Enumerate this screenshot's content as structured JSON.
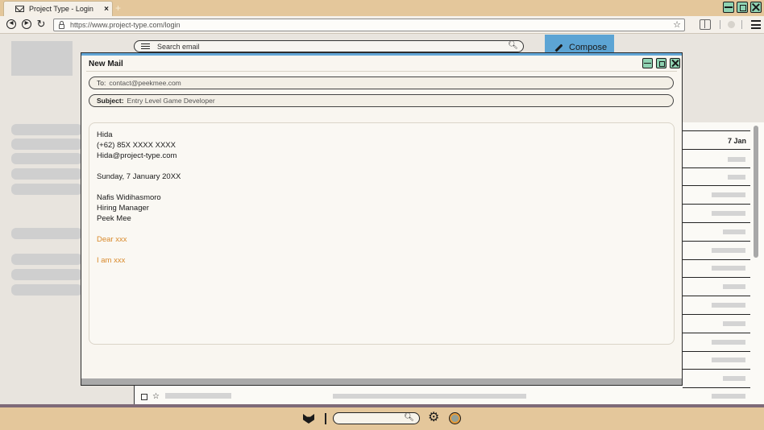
{
  "browser": {
    "tab_title": "Project Type - Login",
    "tab_close": "×",
    "new_tab": "+",
    "url": "https://www.project-type.com/login",
    "star": "☆"
  },
  "app": {
    "search_placeholder": "Search email",
    "compose_label": "Compose",
    "list": {
      "first_date": "7 Jan"
    }
  },
  "new_mail": {
    "title": "New Mail",
    "to_label": "To:",
    "to_value": "contact@peekmee.com",
    "subject_label": "Subject:",
    "subject_value": "Entry Level Game Developer",
    "body": {
      "sender_name": "Hida",
      "sender_phone": "(+62) 85X XXXX XXXX",
      "sender_email": "Hida@project-type.com",
      "date": "Sunday, 7 January 20XX",
      "recipient_name": "Nafis Widihasmoro",
      "recipient_title": "Hiring Manager",
      "recipient_company": "Peek Mee",
      "greeting": "Dear xxx",
      "intro": "I am xxx"
    }
  },
  "colors": {
    "accent_blue": "#5ca4d4",
    "accent_orange": "#d98a2c",
    "chrome_tan": "#e4c79b",
    "window_control_green": "#8fd2b2"
  },
  "icons": {
    "tab": "mail-icon",
    "nav": [
      "back-icon",
      "forward-icon",
      "reload-icon"
    ],
    "dock": [
      "fox-icon",
      "search-icon",
      "gear-icon",
      "globe-icon"
    ]
  }
}
